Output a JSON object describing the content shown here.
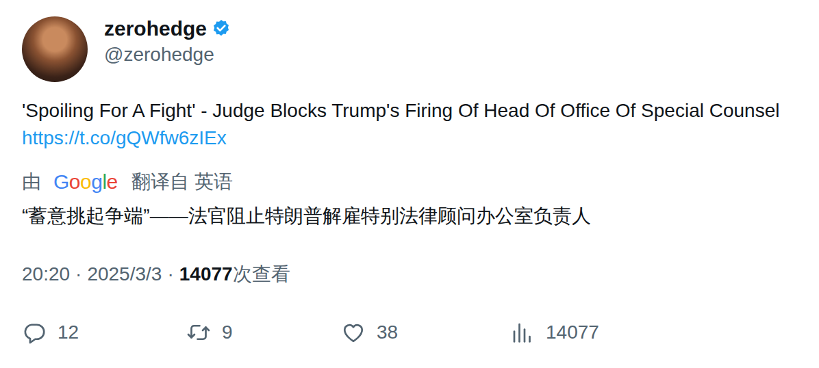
{
  "account": {
    "name": "zerohedge",
    "handle": "@zerohedge",
    "verified": true
  },
  "tweet": {
    "text": "'Spoiling For A Fight' - Judge Blocks Trump's Firing Of Head Of Office Of Special Counsel",
    "link": "https://t.co/gQWfw6zIEx"
  },
  "translation": {
    "prefix": "由",
    "provider": "Google",
    "suffix": "翻译自 英语",
    "text": "“蓄意挑起争端”——法官阻止特朗普解雇特别法律顾问办公室负责人"
  },
  "meta": {
    "time": "20:20",
    "separator": "·",
    "date": "2025/3/3",
    "views": "14077",
    "views_label": "次查看"
  },
  "actions": [
    {
      "kind": "reply",
      "count": "12"
    },
    {
      "kind": "retweet",
      "count": "9"
    },
    {
      "kind": "like",
      "count": "38"
    },
    {
      "kind": "views",
      "count": "14077"
    }
  ]
}
